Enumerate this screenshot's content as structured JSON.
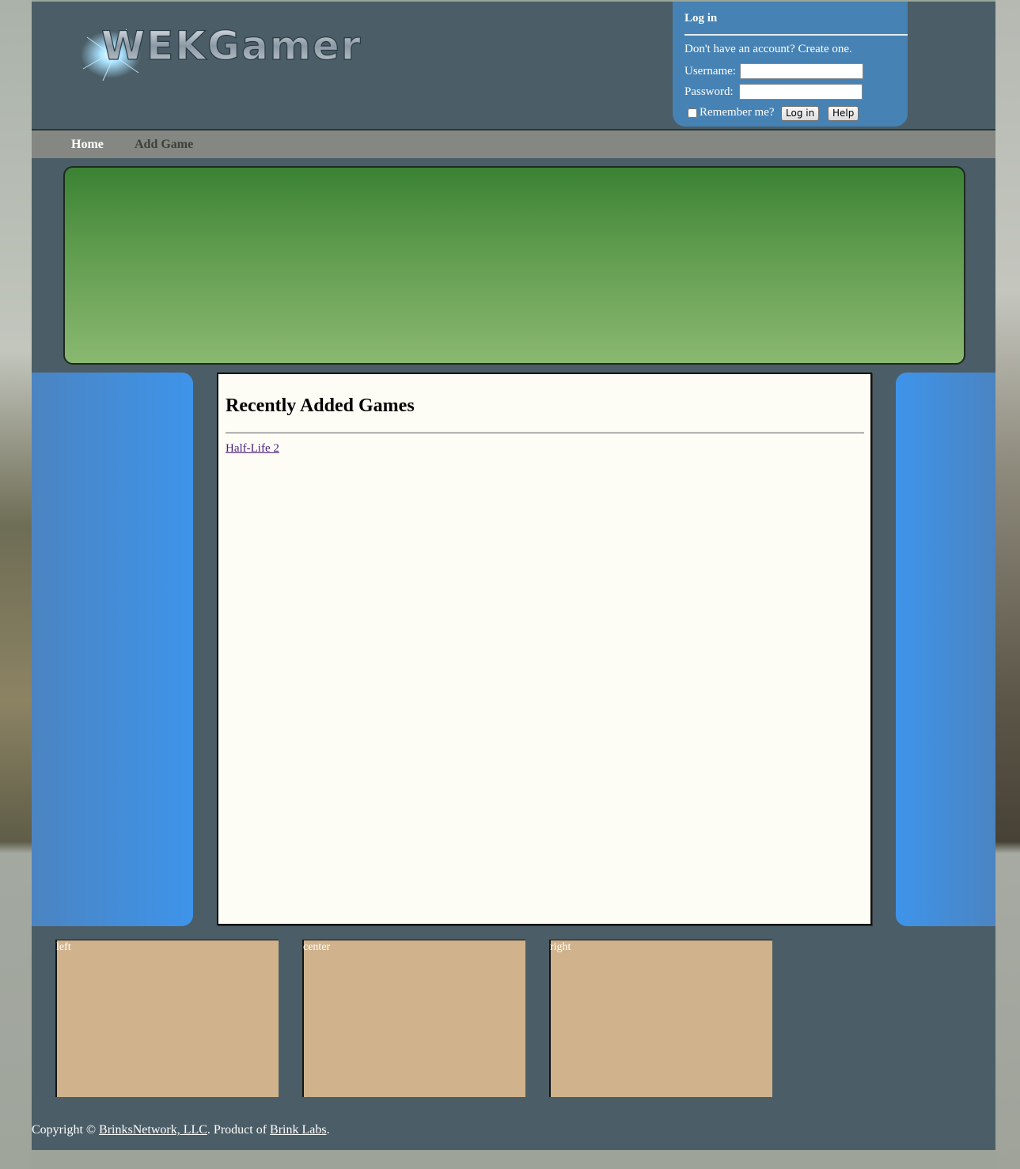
{
  "header": {
    "logo_text": "WEKGamer"
  },
  "login": {
    "title": "Log in",
    "note": "Don't have an account? Create one.",
    "username_label": "Username:",
    "username_value": "",
    "password_label": "Password:",
    "password_value": "",
    "remember_label": "Remember me?",
    "login_button": "Log in",
    "help_button": "Help"
  },
  "nav": {
    "items": [
      {
        "label": "Home"
      },
      {
        "label": "Add Game"
      }
    ]
  },
  "main": {
    "heading": "Recently Added Games",
    "games": [
      {
        "label": "Half-Life 2"
      }
    ]
  },
  "boxes": [
    {
      "label": "left"
    },
    {
      "label": "center"
    },
    {
      "label": "right"
    }
  ],
  "footer": {
    "prefix": "Copyright © ",
    "company_link": "BrinksNetwork, LLC",
    "middle": ". Product of ",
    "labs_link": "Brink Labs",
    "suffix": "."
  },
  "colors": {
    "page_bg": "#4b5d66",
    "login_bg": "#4682b4",
    "nav_bg": "#858782",
    "banner_top": "#3b8234",
    "banner_bottom": "#8ab870",
    "sidebar_blue": "#3e94ea",
    "content_bg": "#fdfdf6",
    "box_bg": "#d0b38c"
  }
}
